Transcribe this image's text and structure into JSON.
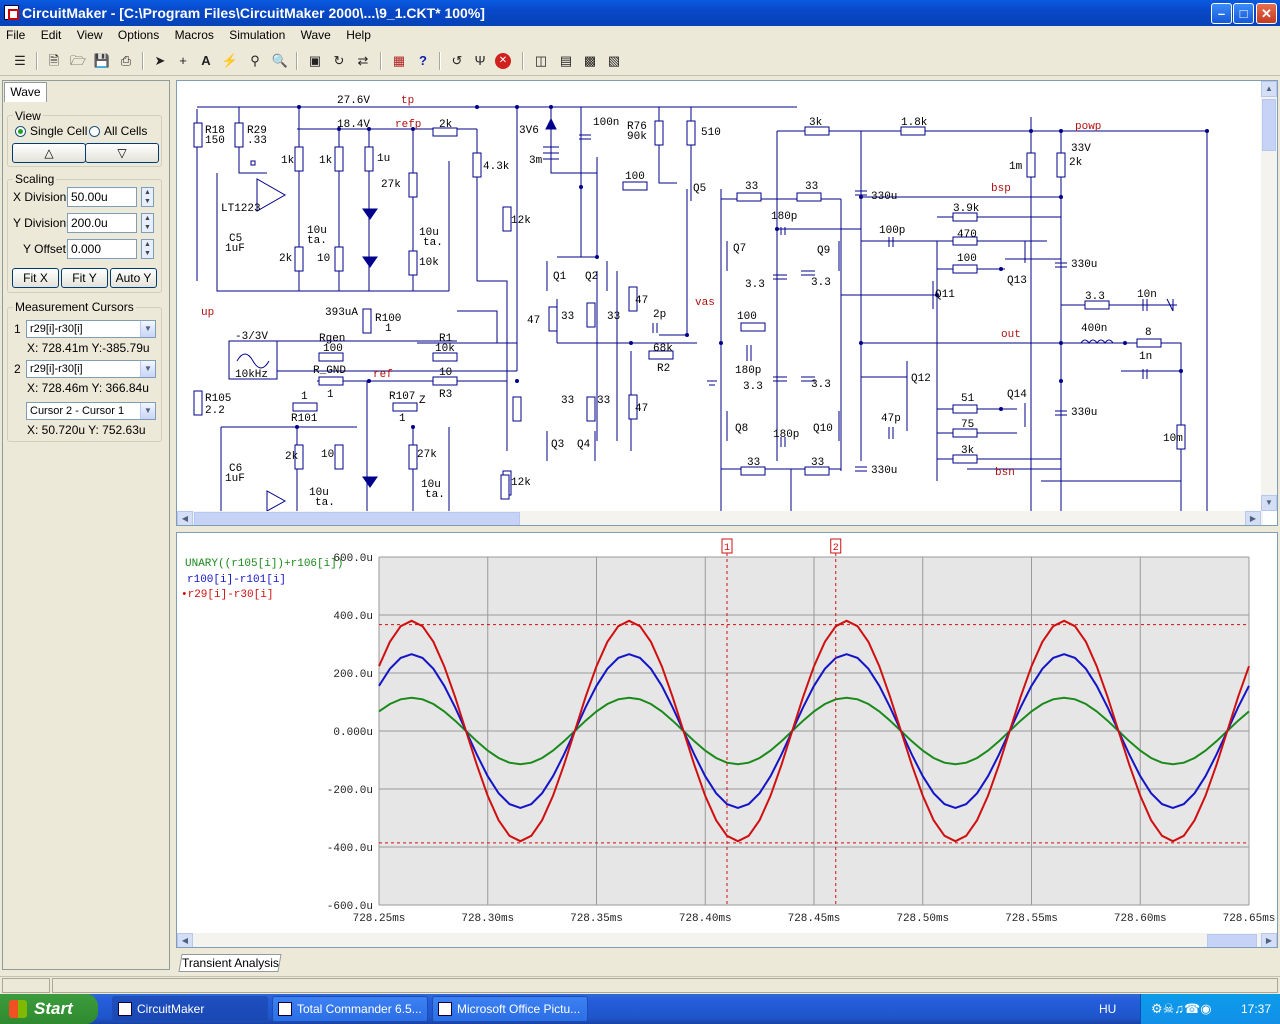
{
  "window": {
    "title": "CircuitMaker - [C:\\Program Files\\CircuitMaker 2000\\...\\9_1.CKT* 100%]",
    "min": "–",
    "max": "□",
    "close": "✕"
  },
  "menu": [
    "File",
    "Edit",
    "View",
    "Options",
    "Macros",
    "Simulation",
    "Wave",
    "Help"
  ],
  "left_panel": {
    "tab": "Wave",
    "view": {
      "label": "View",
      "single_cell": "Single Cell",
      "all_cells": "All Cells",
      "up": "△",
      "down": "▽"
    },
    "scaling": {
      "label": "Scaling",
      "x_division_label": "X Division",
      "x_division_value": "50.00u",
      "y_division_label": "Y Division",
      "y_division_value": "200.0u",
      "y_offset_label": "Y Offset",
      "y_offset_value": "0.000",
      "fit_x": "Fit X",
      "fit_y": "Fit Y",
      "auto_y": "Auto Y"
    },
    "cursors": {
      "label": "Measurement Cursors",
      "c1_num": "1",
      "c1_value": "r29[i]-r30[i]",
      "c1_readout": "X: 728.41m  Y:-385.79u",
      "c2_num": "2",
      "c2_value": "r29[i]-r30[i]",
      "c2_readout": "X: 728.46m  Y: 366.84u",
      "diff_value": "Cursor 2 - Cursor 1",
      "diff_readout": "X: 50.720u  Y: 752.63u"
    }
  },
  "schematic": {
    "labels": {
      "v276": "27.6V",
      "tp": "tp",
      "v184": "18.4V",
      "refp": "refp",
      "r2k_a": "2k",
      "r18": "R18",
      "r18v": "150",
      "r29": "R29",
      "r29v": ".33",
      "k1a": "1k",
      "k1b": "1k",
      "u1": "1u",
      "k27": "27k",
      "lt": "LT1223",
      "c5": "C5",
      "c5v": "1uF",
      "k2a": "2k",
      "t10a": "10",
      "cap10a": "10u",
      "ta1": "ta.",
      "cap10b": "10u",
      "ta2": "ta.",
      "k10": "10k",
      "k43": "4.3k",
      "up": "up",
      "v3v6": "3V6",
      "m3": "3m",
      "n100": "100n",
      "r76": "R76",
      "r76v": "90k",
      "r510": "510",
      "k12a": "12k",
      "q1": "Q1",
      "q2": "Q2",
      "q3": "Q3",
      "q4": "Q4",
      "q5": "Q5",
      "r100a": "100",
      "r33a": "33",
      "r33b": "33",
      "r47a": "47",
      "r47b": "47",
      "r47c": "47",
      "r33c": "33",
      "r33d": "33",
      "p2": "2p",
      "vas": "vas",
      "k68": "68k",
      "r2": "R2",
      "ua393": "393uA",
      "r100": "R100",
      "r100v": "1",
      "rgen": "Rgen",
      "rgenv": "100",
      "r1": "R1",
      "r1v": "10k",
      "src": "-3/3V",
      "srcf": "10kHz",
      "rgnd": "R_GND",
      "rgndv": "1",
      "ref": "ref",
      "r3v": "10",
      "r3": "R3",
      "r105": "R105",
      "r105v": "2.2",
      "r101v": "1",
      "r101": "R101",
      "r107": "R107",
      "r107v": "1",
      "z": "Z",
      "c6": "C6",
      "c6v": "1uF",
      "k2b": "2k",
      "t10b": "10",
      "cap10c": "10u",
      "ta3": "ta.",
      "k27b": "27k",
      "cap10d": "10u",
      "ta4": "ta.",
      "k12b": "12k",
      "k3a": "3k",
      "k18": "1.8k",
      "powp": "powp",
      "r33e": "33",
      "r33f": "33",
      "p180a": "180p",
      "q7": "Q7",
      "q9": "Q9",
      "v33a": "3.3",
      "v33b": "3.3",
      "u330a": "330u",
      "p100": "100p",
      "k39": "3.9k",
      "r470": "470",
      "r100b": "100",
      "bsp": "bsp",
      "m1": "1m",
      "v33": "33V",
      "k2c": "2k",
      "q13": "Q13",
      "q11": "Q11",
      "u330b": "330u",
      "r33g": "3.3",
      "n10": "10n",
      "out": "out",
      "n400": "400n",
      "r8": "8",
      "n1": "1n",
      "r100c": "100",
      "p180b": "180p",
      "v33c": "3.3",
      "v33d": "3.3",
      "q12": "Q12",
      "r51": "51",
      "q14": "Q14",
      "p47": "47p",
      "r75": "75",
      "u330c": "330u",
      "q8": "Q8",
      "q10": "Q10",
      "p180c": "180p",
      "k3b": "3k",
      "m10": "10m",
      "r33h": "33",
      "r33i": "33",
      "u330d": "330u",
      "bsn": "bsn"
    }
  },
  "wave": {
    "legend": [
      {
        "label": "UNARY((r105[i])+r106[i])",
        "color": "#1A8A1A"
      },
      {
        "label": "r100[i]-r101[i]",
        "color": "#1515C8"
      },
      {
        "label": "•r29[i]-r30[i]",
        "color": "#D01010"
      }
    ],
    "cursor1": "1",
    "cursor2": "2",
    "bottom_tab": "Transient Analysis"
  },
  "chart_data": {
    "type": "line",
    "xlabel": "",
    "ylabel": "",
    "xlim": [
      728.25,
      728.65
    ],
    "ylim": [
      -600,
      600
    ],
    "x_ticks": [
      "728.25ms",
      "728.30ms",
      "728.35ms",
      "728.40ms",
      "728.45ms",
      "728.50ms",
      "728.55ms",
      "728.60ms",
      "728.65ms"
    ],
    "y_ticks": [
      "600.0u",
      "400.0u",
      "200.0u",
      "0.000u",
      "-200.0u",
      "-400.0u",
      "-600.0u"
    ],
    "grid": true,
    "period_ms": 0.1,
    "series": [
      {
        "name": "UNARY((r105[i])+r106[i])",
        "color": "#1A8A1A",
        "amplitude_u": 115,
        "peak_x_ms": 728.265
      },
      {
        "name": "r100[i]-r101[i]",
        "color": "#1515C8",
        "amplitude_u": 265,
        "peak_x_ms": 728.265
      },
      {
        "name": "r29[i]-r30[i]",
        "color": "#D01010",
        "amplitude_u": 380,
        "peak_x_ms": 728.265
      }
    ],
    "cursors": [
      {
        "label": "1",
        "x_ms": 728.41,
        "y_u": -385.79
      },
      {
        "label": "2",
        "x_ms": 728.46,
        "y_u": 366.84
      }
    ]
  },
  "taskbar": {
    "start": "Start",
    "tasks": [
      "CircuitMaker",
      "Total Commander 6.5...",
      "Microsoft Office Pictu..."
    ],
    "lang": "HU",
    "clock": "17:37"
  }
}
